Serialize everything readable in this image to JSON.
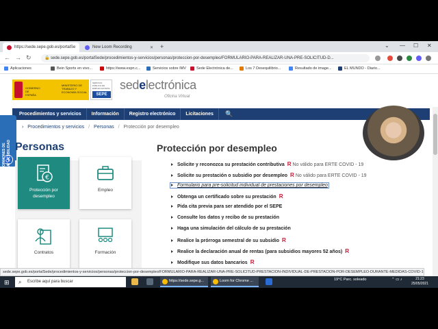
{
  "browser": {
    "tabs": [
      {
        "label": "https://sede.sepe.gob.es/portalSe",
        "active": true
      },
      {
        "label": "New Loom Recording",
        "active": false
      }
    ],
    "new_tab": "+",
    "window_controls": [
      "⌄",
      "—",
      "☐",
      "✕"
    ],
    "url": "sede.sepe.gob.es/portalSede/procedimientos-y-servicios/personas/proteccion-por-desempleo/FORMULARIO-PARA-REALIZAR-UNA-PRE-SOLICITUD-D..."
  },
  "bookmarks": [
    "Aplicaciones",
    "Bein Sports en vivo...",
    "https://www.espn.c...",
    "Servicios sobre IMV",
    "Sede Electrónica de...",
    "Los 7 Desequilibrio...",
    "Resultado de image...",
    "EL MUNDO - Diario..."
  ],
  "header": {
    "gob_text": "GOBIERNO DE ESPAÑA",
    "ministry_text": "MINISTERIO DE TRABAJO Y ECONOMÍA SOCIAL",
    "sepe_small": "SERVICIO PÚBLICO DE EMPLEO ESTATAL",
    "sepe": "SEPE",
    "sede_prefix": "sed",
    "sede_e": "e",
    "sede_suffix": "lectrónica",
    "sede_sub": "Oficina Virtual"
  },
  "nav": {
    "items": [
      "Procedimientos y servicios",
      "Información",
      "Registro electrónico",
      "Licitaciones"
    ],
    "search_icon": "🔍"
  },
  "accessibility": {
    "label": "OPCIONES DE ACCESIBILIDAD"
  },
  "breadcrumb": {
    "items": [
      "Procedimientos y servicios",
      "Personas",
      "Protección por desempleo"
    ]
  },
  "left": {
    "title": "Personas",
    "cards": [
      {
        "label": "Protección por desempleo",
        "icon": "euro-document-icon",
        "active": true
      },
      {
        "label": "Empleo",
        "icon": "briefcase-icon",
        "active": false
      },
      {
        "label": "Contratos",
        "icon": "person-document-icon",
        "active": false
      },
      {
        "label": "Formación",
        "icon": "classroom-icon",
        "active": false
      }
    ]
  },
  "main": {
    "title": "Protección por desempleo",
    "links": [
      {
        "text": "Solicite y reconozca su prestación contributiva",
        "r": "R",
        "note": "No válido para ERTE COVID - 19"
      },
      {
        "text": "Solicite su prestación o subsidio por desempleo",
        "r": "R",
        "note": "No válido para ERTE COVID - 19"
      },
      {
        "text": "Formulario para pre-solicitud individual de prestaciones por desempleo",
        "r": "",
        "note": "",
        "highlighted": true
      },
      {
        "text": "Obtenga un certificado sobre su prestación",
        "r": "R",
        "note": ""
      },
      {
        "text": "Pida cita previa para ser atendido por el SEPE",
        "r": "",
        "note": ""
      },
      {
        "text": "Consulte los datos y recibo de su prestación",
        "r": "",
        "note": ""
      },
      {
        "text": "Haga una simulación del cálculo de su prestación",
        "r": "",
        "note": ""
      },
      {
        "text": "Realice la prórroga semestral de su subsidio",
        "r": "R",
        "note": ""
      },
      {
        "text": "Realice la declaración anual de rentas (para subsidios mayores 52 años)",
        "r": "R",
        "note": ""
      },
      {
        "text": "Modifique sus datos bancarios",
        "r": "R",
        "note": ""
      }
    ]
  },
  "status_url": "sede.sepe.gob.es/portalSede/procedimientos-y-servicios/personas/proteccion-por-desempleo/FORMULARIO-PARA-REALIZAR-UNA-PRE-SOLICITUD-PRESTACION-INDIVIDUAL-DE-PRESTACION-POR-DESEMPLEO-DURANTE-MEDIDAS-COVID-19...",
  "taskbar": {
    "search_placeholder": "Escribe aquí para buscar",
    "apps": [
      "https://sede.sepe.g...",
      "Loom for Chrome ..."
    ],
    "weather": "19°C  Parc. soleado",
    "time": "21:23",
    "date": "25/05/2021"
  },
  "colors": {
    "navy": "#1d3f73",
    "teal": "#1e8a80",
    "red": "#c8102e"
  }
}
